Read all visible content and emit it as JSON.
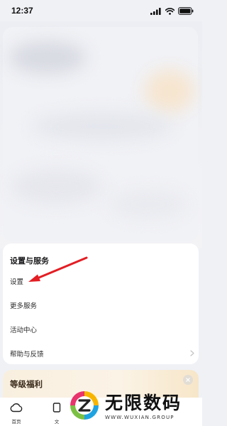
{
  "status_bar": {
    "time": "12:37",
    "icons": [
      "signal-icon",
      "wifi-icon",
      "battery-icon"
    ]
  },
  "settings_section": {
    "title": "设置与服务",
    "items": [
      {
        "label": "设置"
      },
      {
        "label": "更多服务"
      },
      {
        "label": "活动中心"
      },
      {
        "label": "帮助与反馈"
      }
    ]
  },
  "level_card": {
    "title": "等级福利"
  },
  "tab_bar": {
    "tabs": [
      {
        "label": "首页",
        "icon": "cloud-icon"
      },
      {
        "label": "文",
        "icon": "document-icon"
      }
    ]
  },
  "watermark": {
    "title": "无限数码",
    "subtitle": "WWW.WUXIAN.GROUP"
  },
  "annotation": {
    "arrow_color": "#e31e24"
  }
}
